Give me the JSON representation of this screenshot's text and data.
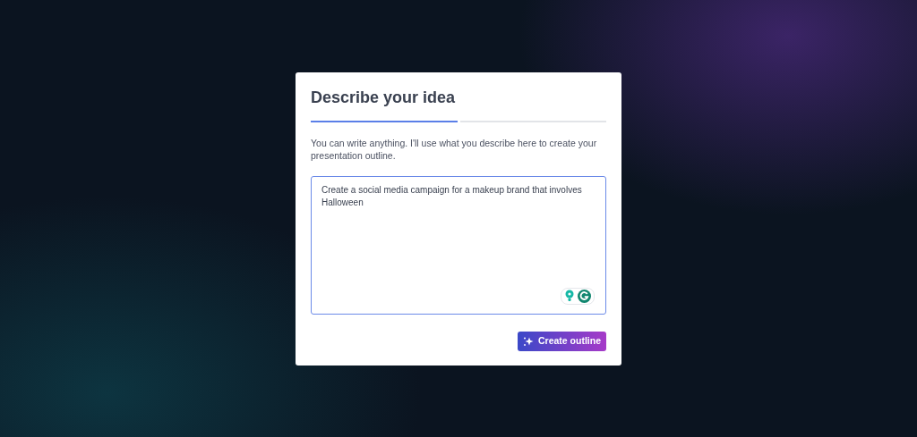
{
  "dialog": {
    "title": "Describe your idea",
    "steps": [
      {
        "selected": true
      },
      {
        "selected": false
      }
    ],
    "description": "You can write anything. I'll use what you describe here to create your presentation outline.",
    "idea_field": {
      "value": "Create a social media campaign for a makeup brand that involves Halloween"
    },
    "create_button": {
      "label": "Create outline"
    }
  }
}
